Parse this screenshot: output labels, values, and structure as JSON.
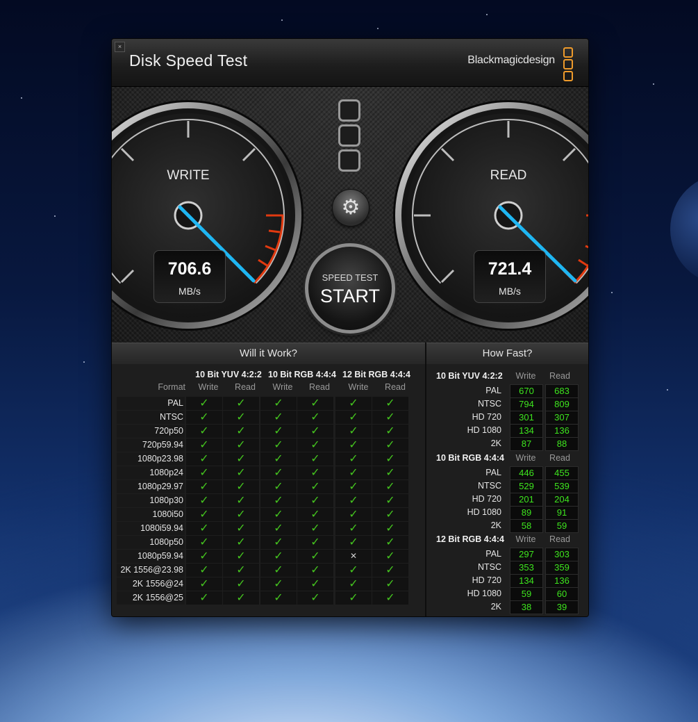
{
  "window": {
    "title": "Disk Speed Test",
    "brand": "Blackmagicdesign",
    "close_glyph": "×"
  },
  "gauges": {
    "write": {
      "label": "WRITE",
      "value": "706.6",
      "unit": "MB/s"
    },
    "read": {
      "label": "READ",
      "value": "721.4",
      "unit": "MB/s"
    }
  },
  "start_button": {
    "small_label": "SPEED TEST",
    "label": "START"
  },
  "settings_icon": "gear-icon",
  "will_it_work": {
    "title": "Will it Work?",
    "format_header": "Format",
    "groups": [
      "10 Bit YUV 4:2:2",
      "10 Bit RGB 4:4:4",
      "12 Bit RGB 4:4:4"
    ],
    "write_header": "Write",
    "read_header": "Read",
    "rows": [
      {
        "format": "PAL",
        "results": [
          "ok",
          "ok",
          "ok",
          "ok",
          "ok",
          "ok"
        ]
      },
      {
        "format": "NTSC",
        "results": [
          "ok",
          "ok",
          "ok",
          "ok",
          "ok",
          "ok"
        ]
      },
      {
        "format": "720p50",
        "results": [
          "ok",
          "ok",
          "ok",
          "ok",
          "ok",
          "ok"
        ]
      },
      {
        "format": "720p59.94",
        "results": [
          "ok",
          "ok",
          "ok",
          "ok",
          "ok",
          "ok"
        ]
      },
      {
        "format": "1080p23.98",
        "results": [
          "ok",
          "ok",
          "ok",
          "ok",
          "ok",
          "ok"
        ]
      },
      {
        "format": "1080p24",
        "results": [
          "ok",
          "ok",
          "ok",
          "ok",
          "ok",
          "ok"
        ]
      },
      {
        "format": "1080p29.97",
        "results": [
          "ok",
          "ok",
          "ok",
          "ok",
          "ok",
          "ok"
        ]
      },
      {
        "format": "1080p30",
        "results": [
          "ok",
          "ok",
          "ok",
          "ok",
          "ok",
          "ok"
        ]
      },
      {
        "format": "1080i50",
        "results": [
          "ok",
          "ok",
          "ok",
          "ok",
          "ok",
          "ok"
        ]
      },
      {
        "format": "1080i59.94",
        "results": [
          "ok",
          "ok",
          "ok",
          "ok",
          "ok",
          "ok"
        ]
      },
      {
        "format": "1080p50",
        "results": [
          "ok",
          "ok",
          "ok",
          "ok",
          "ok",
          "ok"
        ]
      },
      {
        "format": "1080p59.94",
        "results": [
          "ok",
          "ok",
          "ok",
          "ok",
          "fail",
          "ok"
        ]
      },
      {
        "format": "2K 1556@23.98",
        "results": [
          "ok",
          "ok",
          "ok",
          "ok",
          "ok",
          "ok"
        ]
      },
      {
        "format": "2K 1556@24",
        "results": [
          "ok",
          "ok",
          "ok",
          "ok",
          "ok",
          "ok"
        ]
      },
      {
        "format": "2K 1556@25",
        "results": [
          "ok",
          "ok",
          "ok",
          "ok",
          "ok",
          "ok"
        ]
      }
    ],
    "ok_glyph": "✓",
    "fail_glyph": "✕"
  },
  "how_fast": {
    "title": "How Fast?",
    "write_header": "Write",
    "read_header": "Read",
    "groups": [
      {
        "name": "10 Bit YUV 4:2:2",
        "rows": [
          {
            "label": "PAL",
            "write": "670",
            "read": "683"
          },
          {
            "label": "NTSC",
            "write": "794",
            "read": "809"
          },
          {
            "label": "HD 720",
            "write": "301",
            "read": "307"
          },
          {
            "label": "HD 1080",
            "write": "134",
            "read": "136"
          },
          {
            "label": "2K",
            "write": "87",
            "read": "88"
          }
        ]
      },
      {
        "name": "10 Bit RGB 4:4:4",
        "rows": [
          {
            "label": "PAL",
            "write": "446",
            "read": "455"
          },
          {
            "label": "NTSC",
            "write": "529",
            "read": "539"
          },
          {
            "label": "HD 720",
            "write": "201",
            "read": "204"
          },
          {
            "label": "HD 1080",
            "write": "89",
            "read": "91"
          },
          {
            "label": "2K",
            "write": "58",
            "read": "59"
          }
        ]
      },
      {
        "name": "12 Bit RGB 4:4:4",
        "rows": [
          {
            "label": "PAL",
            "write": "297",
            "read": "303"
          },
          {
            "label": "NTSC",
            "write": "353",
            "read": "359"
          },
          {
            "label": "HD 720",
            "write": "134",
            "read": "136"
          },
          {
            "label": "HD 1080",
            "write": "59",
            "read": "60"
          },
          {
            "label": "2K",
            "write": "38",
            "read": "39"
          }
        ]
      }
    ]
  },
  "colors": {
    "needle": "#1fb6f2",
    "redline": "#e13a10",
    "value_green": "#3ee61e",
    "check_green": "#45c51f",
    "logo_orange": "#ef9b2b"
  }
}
